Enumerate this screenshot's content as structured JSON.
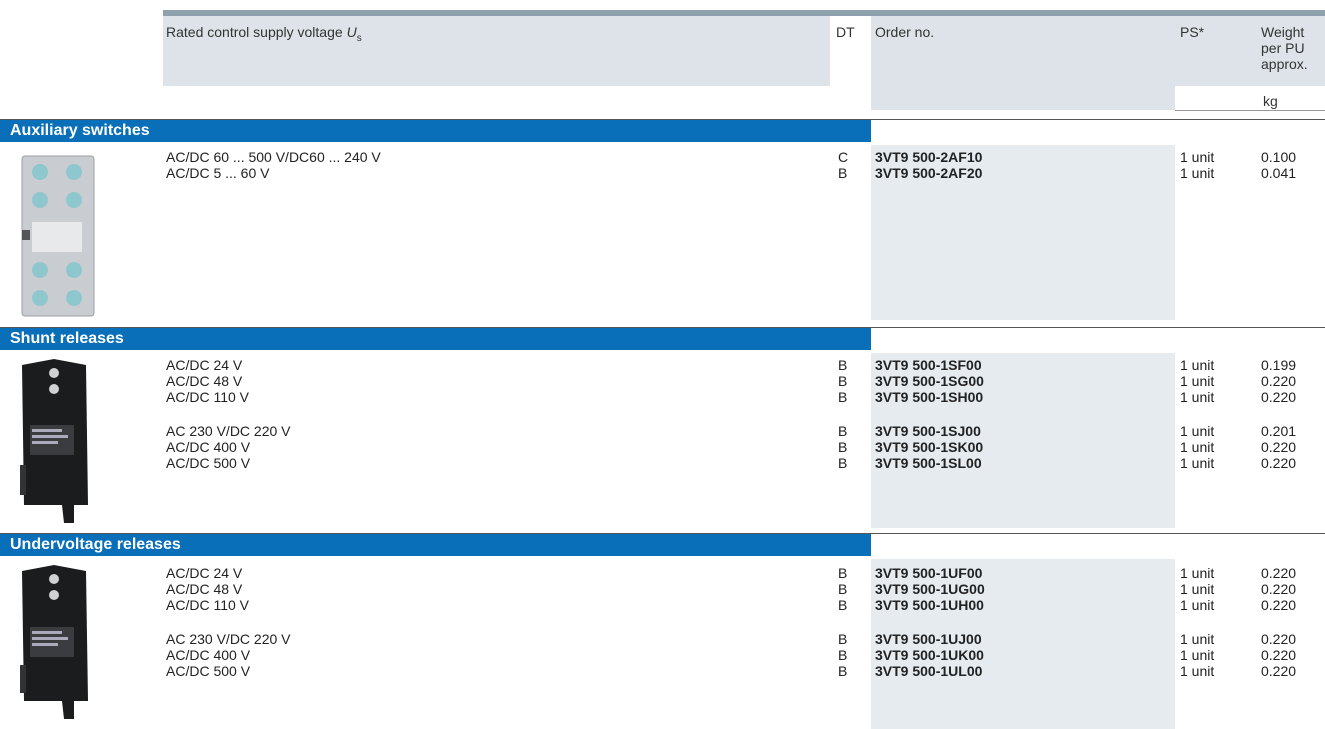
{
  "header": {
    "voltage_label": "Rated control supply voltage",
    "voltage_symbol": "U",
    "voltage_sub": "s",
    "dt": "DT",
    "order_no": "Order no.",
    "ps": "PS*",
    "weight_l1": "Weight",
    "weight_l2": "per PU",
    "weight_l3": "approx.",
    "weight_unit": "kg"
  },
  "sections": [
    {
      "title": "Auxiliary switches",
      "rows": [
        {
          "desc": "AC/DC 60 ... 500 V/DC60 ... 240 V",
          "dt": "C",
          "order": "3VT9 500-2AF10",
          "ps": "1 unit",
          "weight": "0.100"
        },
        {
          "desc": "AC/DC 5 ... 60 V",
          "dt": "B",
          "order": "3VT9 500-2AF20",
          "ps": "1 unit",
          "weight": "0.041"
        }
      ]
    },
    {
      "title": "Shunt releases",
      "rows": [
        {
          "desc": "AC/DC 24 V",
          "dt": "B",
          "order": "3VT9 500-1SF00",
          "ps": "1 unit",
          "weight": "0.199"
        },
        {
          "desc": "AC/DC 48 V",
          "dt": "B",
          "order": "3VT9 500-1SG00",
          "ps": "1 unit",
          "weight": "0.220"
        },
        {
          "desc": "AC/DC 110 V",
          "dt": "B",
          "order": "3VT9 500-1SH00",
          "ps": "1 unit",
          "weight": "0.220"
        },
        {
          "desc": "AC 230 V/DC 220 V",
          "dt": "B",
          "order": "3VT9 500-1SJ00",
          "ps": "1 unit",
          "weight": "0.201"
        },
        {
          "desc": "AC/DC 400 V",
          "dt": "B",
          "order": "3VT9 500-1SK00",
          "ps": "1 unit",
          "weight": "0.220"
        },
        {
          "desc": "AC/DC 500 V",
          "dt": "B",
          "order": "3VT9 500-1SL00",
          "ps": "1 unit",
          "weight": "0.220"
        }
      ]
    },
    {
      "title": "Undervoltage releases",
      "rows": [
        {
          "desc": "AC/DC 24 V",
          "dt": "B",
          "order": "3VT9 500-1UF00",
          "ps": "1 unit",
          "weight": "0.220"
        },
        {
          "desc": "AC/DC 48 V",
          "dt": "B",
          "order": "3VT9 500-1UG00",
          "ps": "1 unit",
          "weight": "0.220"
        },
        {
          "desc": "AC/DC 110 V",
          "dt": "B",
          "order": "3VT9 500-1UH00",
          "ps": "1 unit",
          "weight": "0.220"
        },
        {
          "desc": "AC 230 V/DC 220 V",
          "dt": "B",
          "order": "3VT9 500-1UJ00",
          "ps": "1 unit",
          "weight": "0.220"
        },
        {
          "desc": "AC/DC 400 V",
          "dt": "B",
          "order": "3VT9 500-1UK00",
          "ps": "1 unit",
          "weight": "0.220"
        },
        {
          "desc": "AC/DC 500 V",
          "dt": "B",
          "order": "3VT9 500-1UL00",
          "ps": "1 unit",
          "weight": "0.220"
        }
      ]
    }
  ],
  "icons": {
    "aux_switch": "auxiliary-switch-photo",
    "shunt_release": "shunt-release-photo",
    "undervoltage_release": "undervoltage-release-photo"
  }
}
